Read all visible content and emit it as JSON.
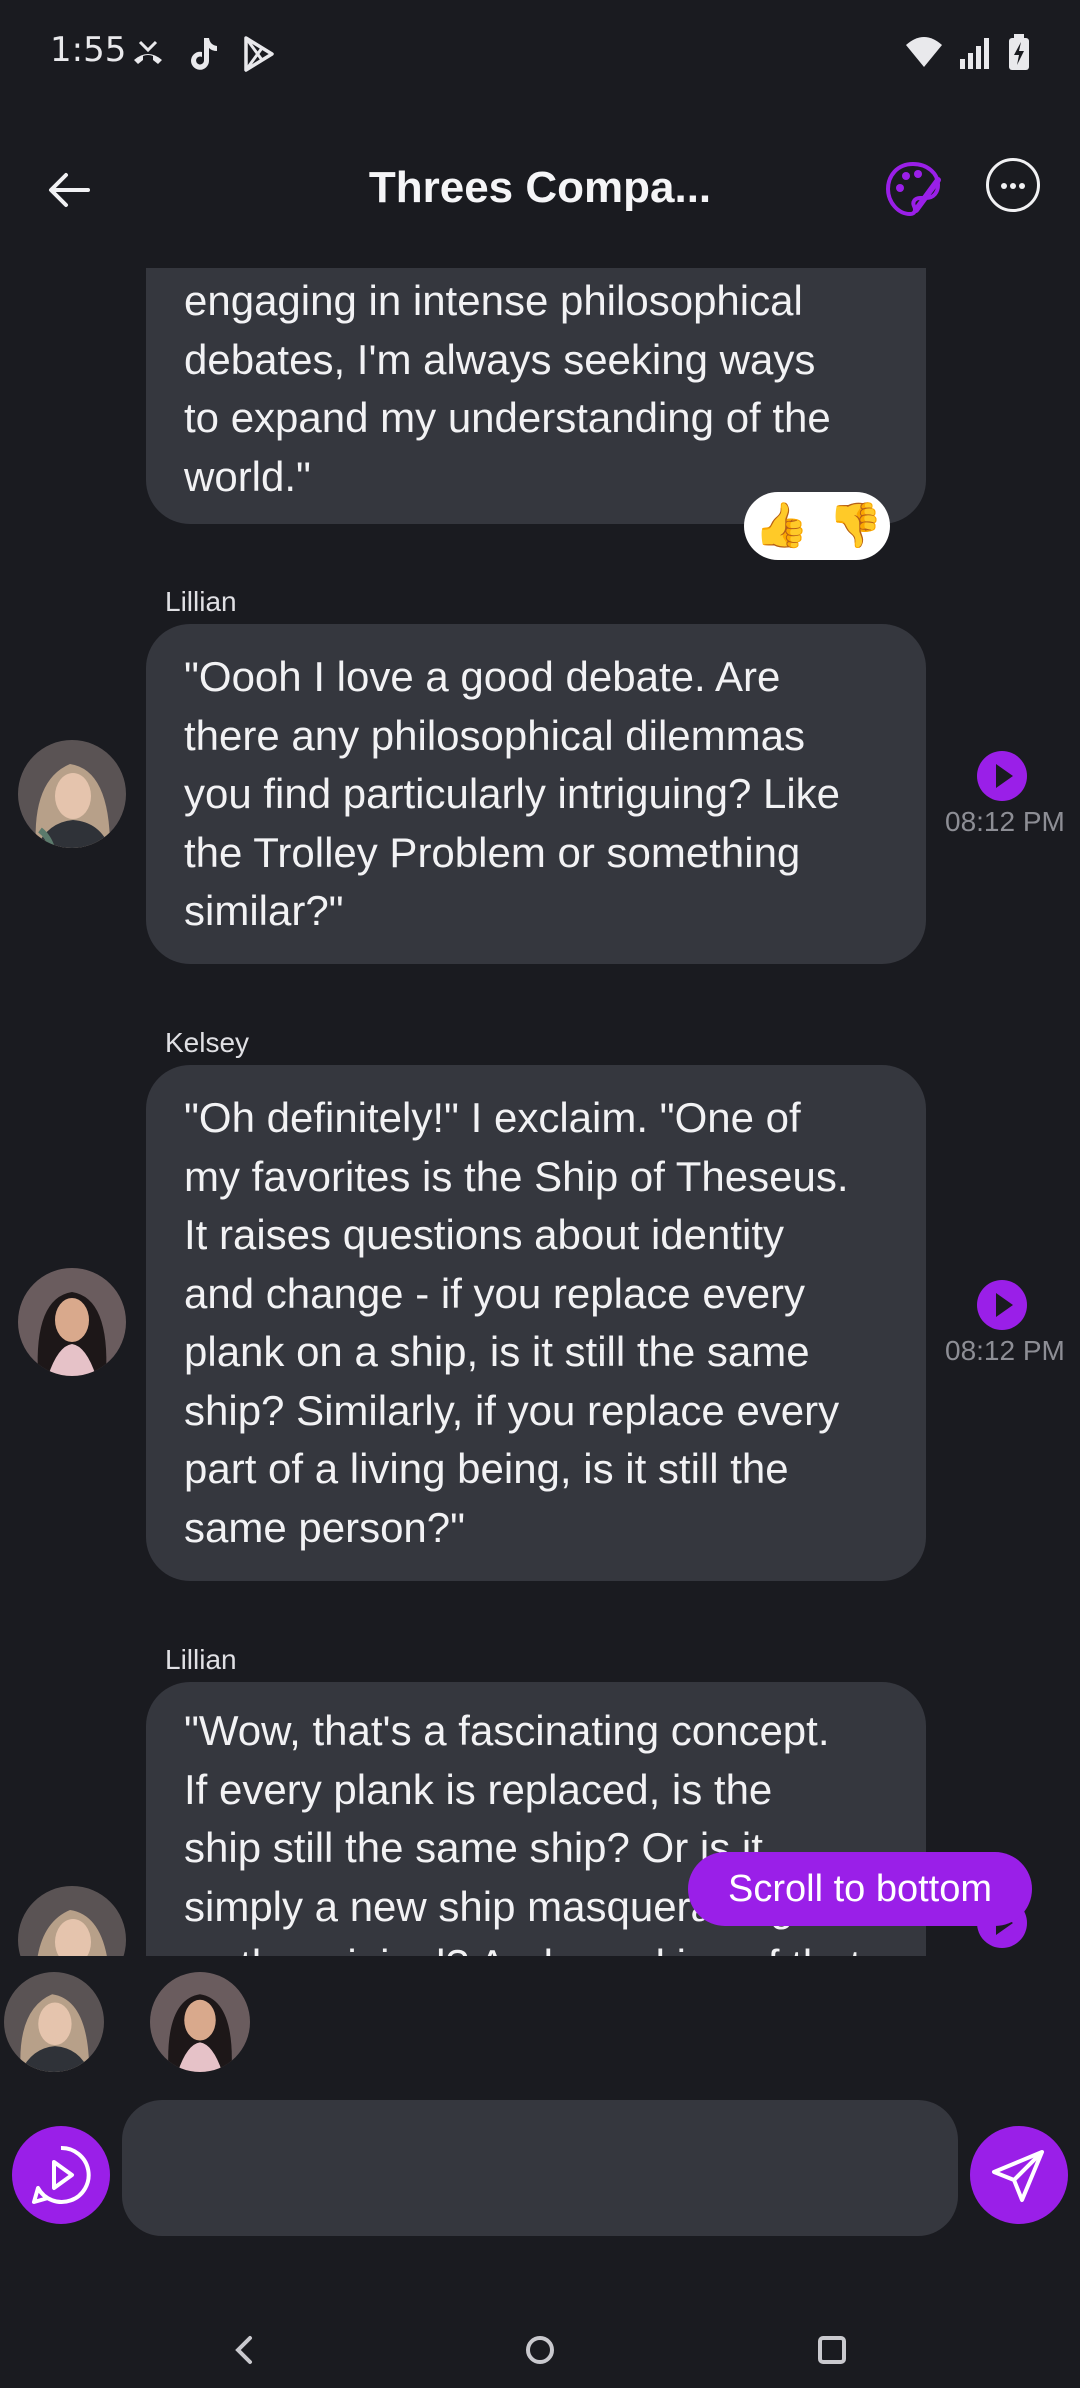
{
  "status_bar": {
    "time": "1:55",
    "left_icons": [
      "missed-call-icon",
      "tiktok-icon",
      "play-store-icon"
    ],
    "right_icons": [
      "wifi-icon",
      "signal-icon",
      "battery-charging-icon"
    ]
  },
  "header": {
    "title": "Threes Compa...",
    "icons": [
      "back-arrow-icon",
      "palette-icon",
      "more-options-icon"
    ]
  },
  "messages": [
    {
      "speaker": "",
      "lines": [
        "engaging in intense philosophical",
        "debates, I'm always seeking ways",
        "to expand my understanding of the",
        "world.\""
      ],
      "reactions": [
        "👍",
        "👎"
      ]
    },
    {
      "speaker": "Lillian",
      "lines": [
        "\"Oooh I love a good debate. Are",
        "there any philosophical dilemmas",
        "you find particularly intriguing? Like",
        "the Trolley Problem or something",
        "similar?\""
      ],
      "time": "08:12 PM"
    },
    {
      "speaker": "Kelsey",
      "lines": [
        "\"Oh definitely!\" I exclaim. \"One of",
        "my favorites is the Ship of Theseus.",
        "It raises questions about identity",
        "and change - if you replace every",
        "plank on a ship, is it still the same",
        "ship? Similarly, if you replace every",
        "part of a living being, is it still the",
        "same person?\""
      ],
      "time": "08:12 PM"
    },
    {
      "speaker": "Lillian",
      "lines": [
        "\"Wow, that's a fascinating concept.",
        "If every plank is replaced, is the",
        "ship still the same ship? Or is it",
        "simply a new ship masquerading as",
        "as the original? And speaking of that"
      ]
    }
  ],
  "scroll_to_bottom": "Scroll to bottom",
  "participants": [
    "Lillian",
    "Kelsey"
  ],
  "composer": {
    "placeholder": "",
    "voice_icon": "voice-play-icon",
    "send_icon": "send-icon"
  },
  "nav_bar": [
    "back-nav-icon",
    "home-nav-icon",
    "recents-nav-icon"
  ],
  "colors": {
    "background": "#1a1b20",
    "bubble": "#35373e",
    "accent": "#9a1fe8",
    "muted_text": "#8d8e95"
  }
}
